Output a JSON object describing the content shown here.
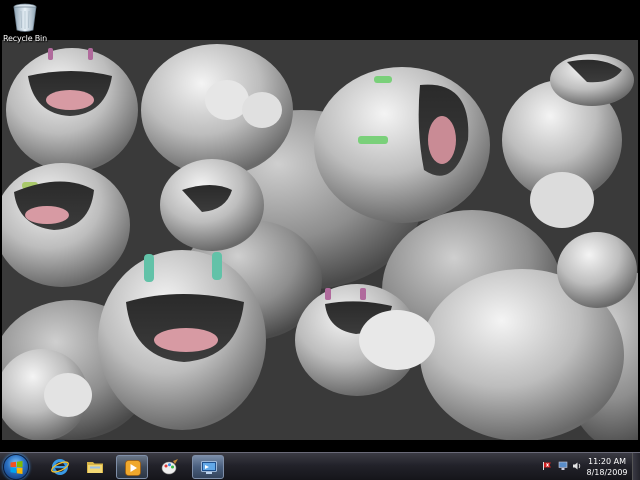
{
  "desktop": {
    "icons": [
      {
        "label": "Recycle Bin",
        "icon": "recycle-bin-icon"
      }
    ]
  },
  "taskbar": {
    "start": {
      "icon": "windows-start-orb-icon"
    },
    "pinned": [
      {
        "icon": "internet-explorer-icon"
      },
      {
        "icon": "windows-explorer-folder-icon"
      },
      {
        "icon": "windows-media-player-icon"
      },
      {
        "icon": "paint-icon"
      },
      {
        "icon": "remote-desktop-icon"
      }
    ],
    "tray": {
      "icons": [
        "action-center-flag-icon",
        "network-icon",
        "volume-icon"
      ],
      "clock": {
        "time": "11:20 AM",
        "date": "8/18/2009"
      }
    }
  },
  "colors": {
    "taskbar": "#1c1c22",
    "desktop_frame": "#000000",
    "tray_flag": "#d21f1f"
  }
}
